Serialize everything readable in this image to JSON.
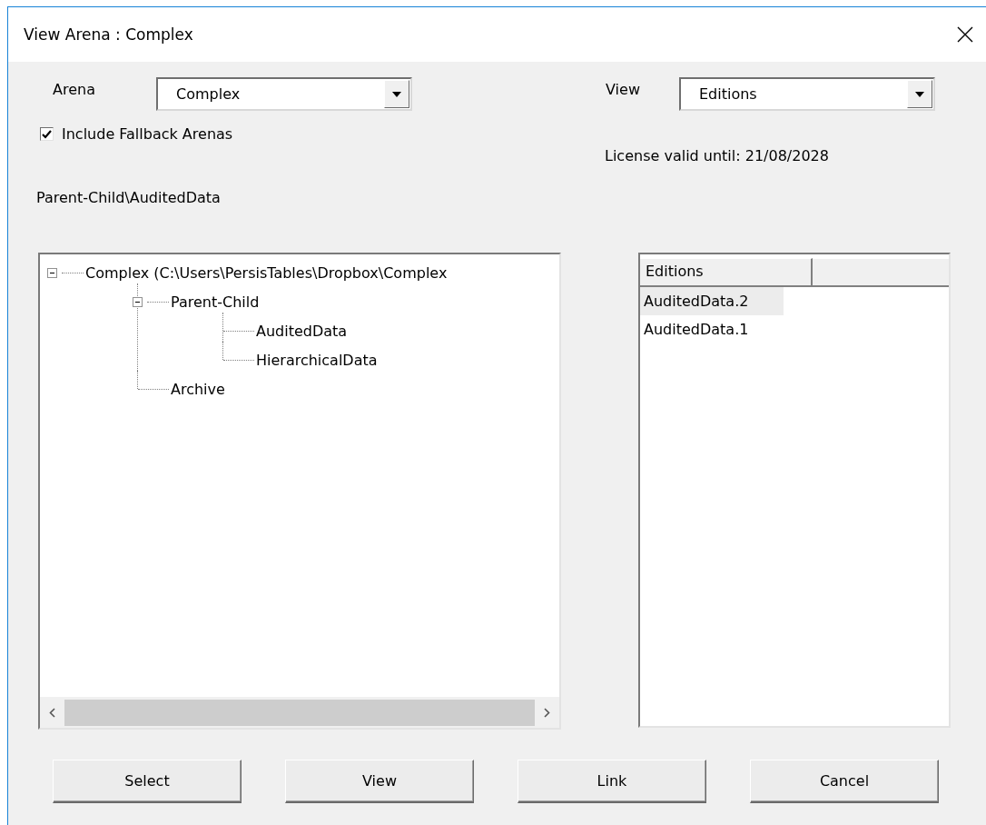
{
  "window": {
    "title": "View Arena : Complex"
  },
  "arena": {
    "label": "Arena",
    "value": "Complex"
  },
  "view": {
    "label": "View",
    "value": "Editions"
  },
  "include_fallback": {
    "label": "Include Fallback Arenas",
    "checked": true
  },
  "license": "License valid until: 21/08/2028",
  "path": "Parent-Child\\AuditedData",
  "tree": [
    {
      "label": "Complex (C:\\Users\\PersisTables\\Dropbox\\Complex",
      "expanded": true,
      "children": [
        {
          "label": "Parent-Child",
          "expanded": true,
          "children": [
            {
              "label": "AuditedData"
            },
            {
              "label": "HierarchicalData"
            }
          ]
        },
        {
          "label": "Archive"
        }
      ]
    }
  ],
  "editions": {
    "columns": [
      "Editions"
    ],
    "items": [
      {
        "label": "AuditedData.2",
        "selected": true
      },
      {
        "label": "AuditedData.1",
        "selected": false
      }
    ]
  },
  "buttons": [
    "Select",
    "View",
    "Link",
    "Cancel"
  ]
}
